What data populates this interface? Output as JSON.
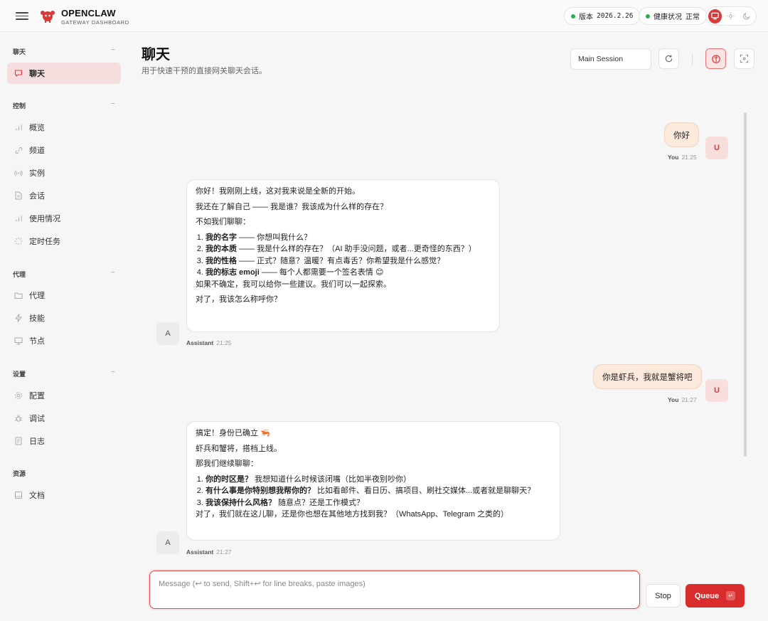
{
  "header": {
    "brand": "OPENCLAW",
    "brand_sub": "GATEWAY DASHBOARD",
    "version_label": "版本",
    "version": "2026.2.26",
    "health_label": "健康状况",
    "health_value": "正常",
    "status_color": "#22b14c",
    "accent": "#d93a3a"
  },
  "sidebar": {
    "sections": [
      {
        "title": "聊天",
        "items": [
          {
            "label": "聊天",
            "icon": "chat-icon",
            "active": true
          }
        ]
      },
      {
        "title": "控制",
        "items": [
          {
            "label": "概览",
            "icon": "bar-chart-icon"
          },
          {
            "label": "频道",
            "icon": "link-icon"
          },
          {
            "label": "实例",
            "icon": "signal-icon"
          },
          {
            "label": "会话",
            "icon": "document-icon"
          },
          {
            "label": "使用情况",
            "icon": "bar-chart-icon"
          },
          {
            "label": "定时任务",
            "icon": "loader-icon"
          }
        ]
      },
      {
        "title": "代理",
        "items": [
          {
            "label": "代理",
            "icon": "folder-icon"
          },
          {
            "label": "技能",
            "icon": "bolt-icon"
          },
          {
            "label": "节点",
            "icon": "monitor-icon"
          }
        ]
      },
      {
        "title": "设置",
        "items": [
          {
            "label": "配置",
            "icon": "gear-icon"
          },
          {
            "label": "调试",
            "icon": "bug-icon"
          },
          {
            "label": "日志",
            "icon": "log-icon"
          }
        ]
      },
      {
        "title": "资源",
        "items": [
          {
            "label": "文档",
            "icon": "book-icon"
          }
        ]
      }
    ],
    "collapse_glyph": "−"
  },
  "main": {
    "title": "聊天",
    "subtitle": "用于快速干预的直接网关聊天会话。",
    "session": "Main Session"
  },
  "messages": [
    {
      "role": "user",
      "avatar": "U",
      "sender": "You",
      "time": "21:25",
      "text": "你好"
    },
    {
      "role": "assistant",
      "avatar": "A",
      "sender": "Assistant",
      "time": "21:25",
      "p1": "你好！我刚刚上线，这对我来说是全新的开始。",
      "p2": "我还在了解自己 —— 我是谁？我该成为什么样的存在？",
      "p3": "不如我们聊聊：",
      "list": [
        {
          "bold": "我的名字",
          "rest": " —— 你想叫我什么？"
        },
        {
          "bold": "我的本质",
          "rest": " —— 我是什么样的存在？（AI 助手没问题，或者...更奇怪的东西？）"
        },
        {
          "bold": "我的性格",
          "rest": " —— 正式？随意？温暖？有点毒舌？你希望我是什么感觉？"
        },
        {
          "bold": "我的标志 emoji",
          "rest": " —— 每个人都需要一个签名表情 😊"
        }
      ],
      "p4": "如果不确定，我可以给你一些建议。我们可以一起探索。",
      "p5": "对了，我该怎么称呼你？"
    },
    {
      "role": "user",
      "avatar": "U",
      "sender": "You",
      "time": "21:27",
      "text": "你是虾兵，我就是蟹将吧"
    },
    {
      "role": "assistant",
      "avatar": "A",
      "sender": "Assistant",
      "time": "21:27",
      "p1": "搞定！身份已确立 🦐",
      "p2": "虾兵和蟹将，搭档上线。",
      "p3": "那我们继续聊聊：",
      "list": [
        {
          "bold": "你的时区是？",
          "rest": " 我想知道什么时候该闭嘴（比如半夜别吵你）"
        },
        {
          "bold": "有什么事是你特别想我帮你的？",
          "rest": " 比如看邮件、看日历、搞项目、刷社交媒体...或者就是聊聊天？"
        },
        {
          "bold": "我该保持什么风格？",
          "rest": " 随意点？还是工作模式？"
        }
      ],
      "p4": "对了，我们就在这儿聊，还是你也想在其他地方找到我？（WhatsApp、Telegram 之类的）"
    }
  ],
  "composer": {
    "placeholder": "Message (↩ to send, Shift+↩ for line breaks, paste images)",
    "stop_label": "Stop",
    "queue_label": "Queue",
    "queue_kbd": "↵"
  }
}
